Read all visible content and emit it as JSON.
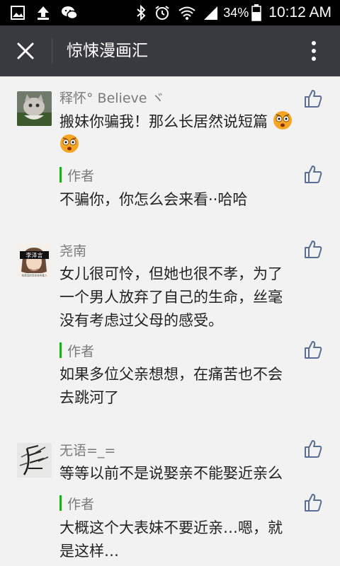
{
  "status_bar": {
    "battery_percent": "34%",
    "time": "10:12 AM"
  },
  "title_bar": {
    "title": "惊悚漫画汇"
  },
  "comments": [
    {
      "name": "释怀° Believe ヾ",
      "text": "搬妹你骗我！那么长居然说短篇",
      "reply": {
        "label": "作者",
        "text": "不骗你，你怎么会来看··哈哈"
      }
    },
    {
      "name": "尧南",
      "avatar_label": "李泽言",
      "avatar_caption": "我是真的李泽言的爱人",
      "text_lines": [
        "女儿很可怜，但她也很不孝，为了",
        "一个男人放弃了自己的生命，丝毫",
        "没有考虑过父母的感受。"
      ],
      "reply": {
        "label": "作者",
        "text_lines": [
          "如果多位父亲想想，在痛苦也不会",
          "去跳河了"
        ]
      }
    },
    {
      "name": "无语=_=",
      "text": "等等以前不是说娶亲不能娶近亲么",
      "reply": {
        "label": "作者",
        "text_lines": [
          "大概这个大表妹不要近亲…嗯，就",
          "是这样…"
        ]
      }
    }
  ],
  "colors": {
    "status_bar_bg": "#000000",
    "title_bar_bg": "#393a3f",
    "page_bg": "#f2f2f2",
    "author_accent": "#09bb07",
    "name_text": "#7a7a7a",
    "like_icon": "#5b6f95"
  },
  "icons": {
    "status_left": [
      "gallery-icon",
      "upload-icon",
      "wechat-icon"
    ],
    "status_right": [
      "bluetooth-icon",
      "alarm-icon",
      "wifi-icon",
      "signal-icon",
      "battery-icon"
    ],
    "title_left": "close-icon",
    "title_right": "more-icon",
    "like": "thumbs-up-icon"
  }
}
